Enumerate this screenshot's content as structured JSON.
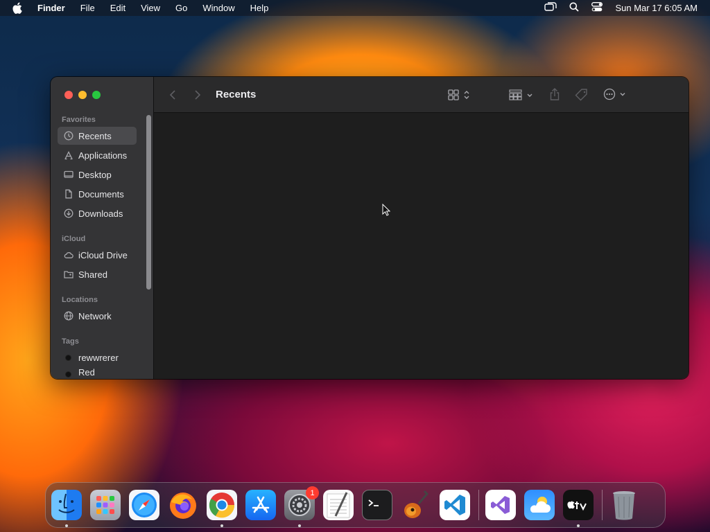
{
  "menubar": {
    "app_name": "Finder",
    "menus": [
      "File",
      "Edit",
      "View",
      "Go",
      "Window",
      "Help"
    ],
    "clock": "Sun Mar 17  6:05 AM"
  },
  "window": {
    "title": "Recents",
    "sidebar": {
      "favorites_title": "Favorites",
      "favorites": [
        {
          "label": "Recents",
          "icon": "clock-icon",
          "selected": true
        },
        {
          "label": "Applications",
          "icon": "applications-icon"
        },
        {
          "label": "Desktop",
          "icon": "desktop-icon"
        },
        {
          "label": "Documents",
          "icon": "document-icon"
        },
        {
          "label": "Downloads",
          "icon": "download-icon"
        }
      ],
      "icloud_title": "iCloud",
      "icloud": [
        {
          "label": "iCloud Drive",
          "icon": "cloud-icon"
        },
        {
          "label": "Shared",
          "icon": "shared-folder-icon"
        }
      ],
      "locations_title": "Locations",
      "locations": [
        {
          "label": "Network",
          "icon": "globe-icon"
        }
      ],
      "tags_title": "Tags",
      "tags": [
        {
          "label": "rewwrerer",
          "color": "#111111"
        },
        {
          "label": "Red",
          "color": "#111111"
        }
      ]
    }
  },
  "dock": {
    "apps": [
      {
        "name": "finder-icon",
        "running": true
      },
      {
        "name": "launchpad-icon"
      },
      {
        "name": "safari-icon"
      },
      {
        "name": "firefox-icon"
      },
      {
        "name": "chrome-icon",
        "running": true
      },
      {
        "name": "app-store-icon"
      },
      {
        "name": "system-settings-icon",
        "running": true,
        "badge": "1"
      },
      {
        "name": "textedit-icon"
      },
      {
        "name": "terminal-icon"
      },
      {
        "name": "garageband-icon"
      },
      {
        "name": "vscode-icon"
      },
      {
        "name": "visual-studio-icon"
      },
      {
        "name": "weather-icon"
      },
      {
        "name": "apple-tv-icon",
        "running": true
      },
      {
        "name": "trash-icon"
      }
    ]
  },
  "colors": {
    "window_bg": "#1e1e1e",
    "sidebar_bg": "#343436",
    "toolbar_bg": "#2a2a2b",
    "close": "#fe5f57",
    "minimize": "#febc2e",
    "zoom": "#28c840",
    "badge": "#ff3b30"
  }
}
